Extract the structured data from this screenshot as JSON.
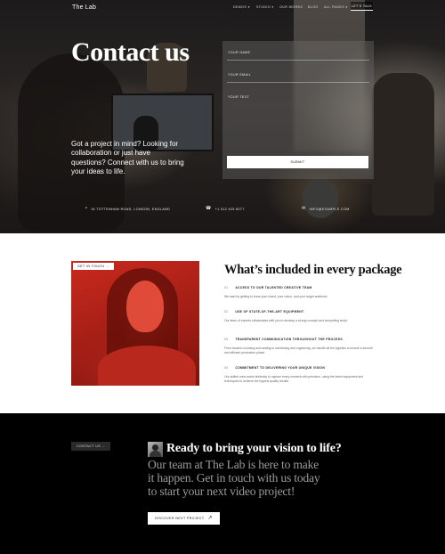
{
  "nav": {
    "logo": "The Lab",
    "items": [
      {
        "label": "DEMOS ▾"
      },
      {
        "label": "STUDIO ▾"
      },
      {
        "label": "OUR WORKS"
      },
      {
        "label": "BLOG"
      },
      {
        "label": "ALL PAGES ▾"
      }
    ],
    "cta_label": "LET'S TALK"
  },
  "hero": {
    "title": "Contact us",
    "lead": "Got a project in mind? Looking for collaboration or just have questions? Connect with us to bring your ideas to life.",
    "form": {
      "name_label": "YOUR NAME",
      "email_label": "YOUR EMAIL",
      "text_label": "YOUR TEXT",
      "submit_label": "SUBMIT"
    },
    "contact": {
      "address": "16 TOTTENHAM ROAD, LONDON, ENGLAND",
      "phone": "+1 012 425 6077",
      "email": "INFO@EXAMPLE.COM",
      "address_icon": "location-pin-icon",
      "phone_icon": "phone-icon",
      "email_icon": "mail-icon"
    }
  },
  "package": {
    "badge": "GET IN TOUCH →",
    "title": "What’s included in every package",
    "features": [
      {
        "num": "01",
        "title": "ACCESS TO OUR TALENTED CREATIVE TEAM",
        "desc": "We start by getting to know your brand, your vision, and your target audience."
      },
      {
        "num": "02",
        "title": "USE OF STATE-OF-THE-ART EQUIPMENT",
        "desc": "Our team of experts collaborates with you to develop a strong concept and compelling script."
      },
      {
        "num": "03",
        "title": "TRANSPARENT COMMUNICATION THROUGHOUT THE PROCESS",
        "desc": "From location scouting and casting to scheduling and organizing, we handle all the logistics to ensure a smooth and efficient production phase."
      },
      {
        "num": "04",
        "title": "COMMITMENT TO DELIVERING YOUR UNIQUE VISION",
        "desc": "Our skilled crew works tirelessly to capture every moment with precision, using the latest equipment and techniques to achieve the highest quality results."
      }
    ]
  },
  "cta": {
    "contact_button": "CONTACT US →",
    "heading": "Ready to bring your vision to life?",
    "body": "Our team at The Lab is here to make it happen. Get in touch with us today to start your next video project!",
    "discover_button": "DISCOVER NEXT PROJECT",
    "discover_arrow": "↗"
  }
}
